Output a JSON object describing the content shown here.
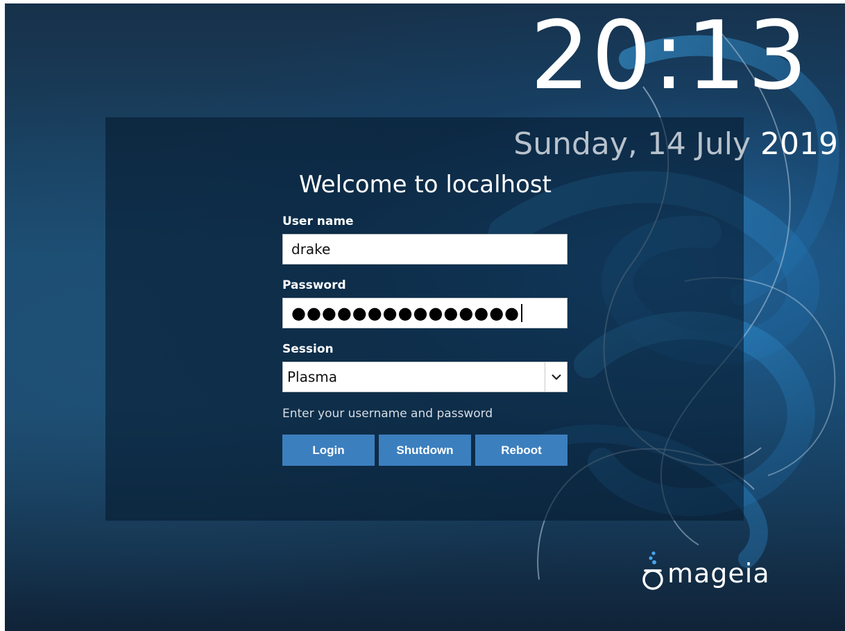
{
  "clock": {
    "time": "20:13"
  },
  "date": {
    "day_month": "Sunday, 14 July",
    "year": "2019"
  },
  "login": {
    "welcome": "Welcome to localhost",
    "username_label": "User name",
    "username_value": "drake",
    "password_label": "Password",
    "password_mask": "●●●●●●●●●●●●●●●",
    "session_label": "Session",
    "session_value": "Plasma",
    "hint": "Enter your username and password"
  },
  "buttons": {
    "login": "Login",
    "shutdown": "Shutdown",
    "reboot": "Reboot"
  },
  "brand": {
    "name": "mageia",
    "accent_color": "#3c7fbe",
    "logo_dots_color": "#4aa3e8"
  },
  "icons": {
    "session_dropdown": "chevron-down-icon",
    "logo": "mageia-logo-icon"
  }
}
